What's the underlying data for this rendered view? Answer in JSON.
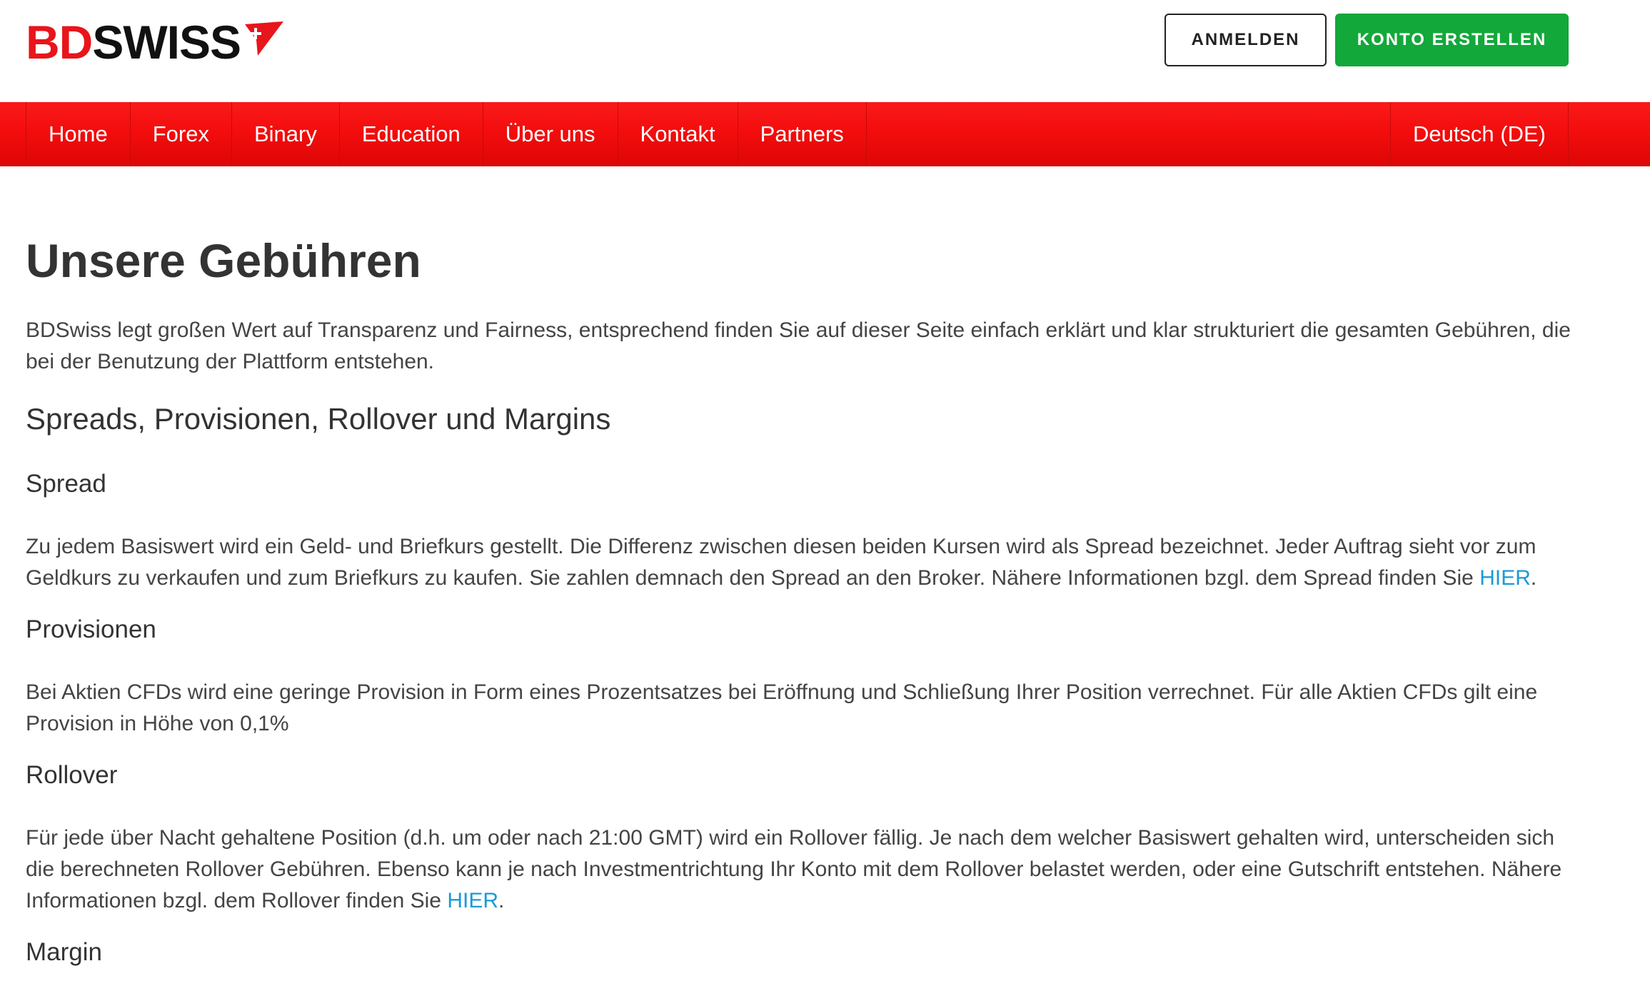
{
  "header": {
    "logo": {
      "text_red": "BD",
      "text_dark": "SWISS"
    },
    "login_label": "ANMELDEN",
    "register_label": "KONTO ERSTELLEN"
  },
  "nav": {
    "items": [
      {
        "label": "Home"
      },
      {
        "label": "Forex"
      },
      {
        "label": "Binary"
      },
      {
        "label": "Education"
      },
      {
        "label": "Über uns"
      },
      {
        "label": "Kontakt"
      },
      {
        "label": "Partners"
      }
    ],
    "language": "Deutsch (DE)"
  },
  "colors": {
    "brand_red": "#e8151b",
    "nav_red": "#f40d0d",
    "cta_green": "#13a83a",
    "link_blue": "#1a9ad6"
  },
  "main": {
    "title": "Unsere Gebühren",
    "intro": "BDSwiss legt großen Wert auf Transparenz und Fairness, entsprechend finden Sie auf dieser Seite einfach erklärt und klar strukturiert die gesamten Gebühren, die bei der Benutzung der Plattform entstehen.",
    "section_title": "Spreads, Provisionen, Rollover und Margins",
    "spread": {
      "title": "Spread",
      "text": "Zu jedem Basiswert wird ein Geld- und Briefkurs gestellt. Die Differenz zwischen diesen beiden Kursen wird als Spread bezeichnet. Jeder Auftrag sieht vor zum Geldkurs zu verkaufen und zum Briefkurs zu kaufen. Sie zahlen demnach den Spread an den Broker. Nähere Informationen bzgl. dem Spread finden Sie ",
      "link": "HIER",
      "suffix": "."
    },
    "provisionen": {
      "title": "Provisionen",
      "text": "Bei Aktien CFDs wird eine geringe Provision in Form eines Prozentsatzes bei Eröffnung und Schließung Ihrer Position verrechnet. Für alle Aktien CFDs gilt eine Provision in Höhe von 0,1%"
    },
    "rollover": {
      "title": "Rollover",
      "text": "Für jede über Nacht gehaltene Position (d.h. um oder nach 21:00 GMT) wird ein Rollover fällig. Je nach dem welcher Basiswert gehalten wird, unterscheiden sich die berechneten Rollover Gebühren. Ebenso kann je nach Investmentrichtung Ihr Konto mit dem Rollover belastet werden, oder eine Gutschrift entstehen. Nähere Informationen bzgl. dem Rollover finden Sie ",
      "link": "HIER",
      "suffix": "."
    },
    "margin": {
      "title": "Margin"
    }
  }
}
